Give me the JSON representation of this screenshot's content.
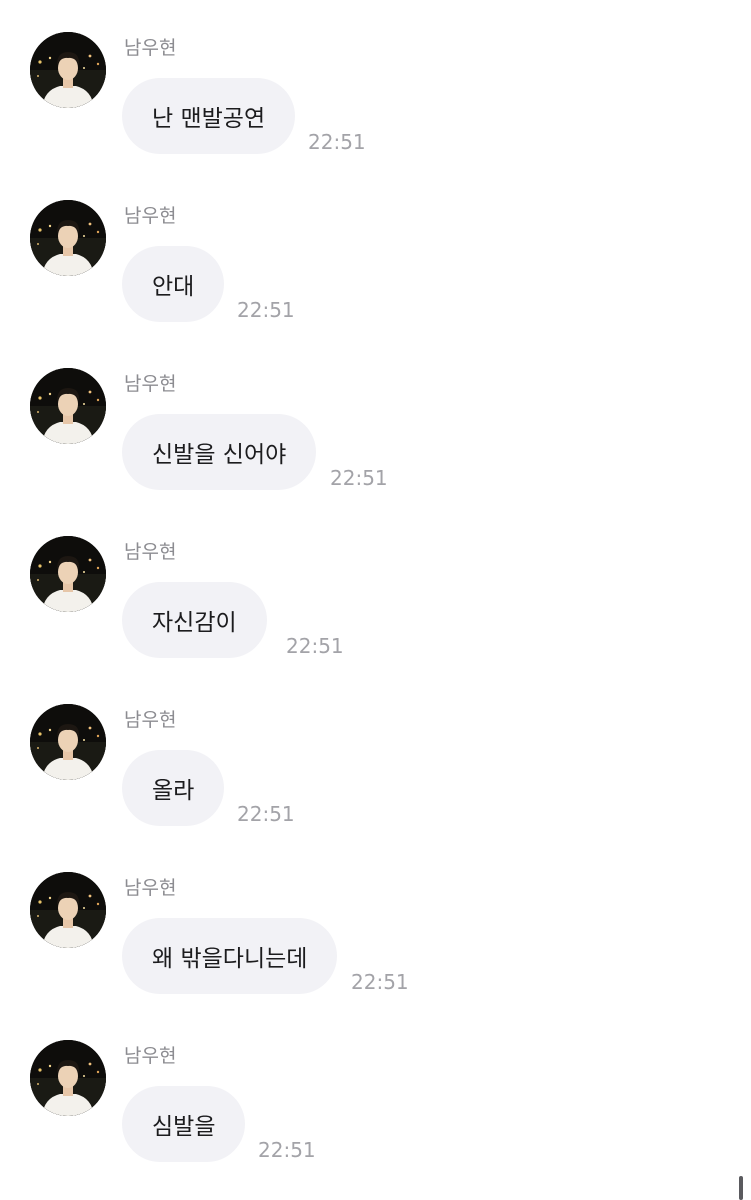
{
  "messages": [
    {
      "sender": "남우현",
      "text": "난 맨발공연",
      "time": "22:51"
    },
    {
      "sender": "남우현",
      "text": "안대",
      "time": "22:51"
    },
    {
      "sender": "남우현",
      "text": "신발을 신어야",
      "time": "22:51"
    },
    {
      "sender": "남우현",
      "text": "자신감이",
      "time": "22:51"
    },
    {
      "sender": "남우현",
      "text": "올라",
      "time": "22:51"
    },
    {
      "sender": "남우현",
      "text": "왜 밖을다니는데",
      "time": "22:51"
    },
    {
      "sender": "남우현",
      "text": "심발을",
      "time": "22:51"
    }
  ]
}
